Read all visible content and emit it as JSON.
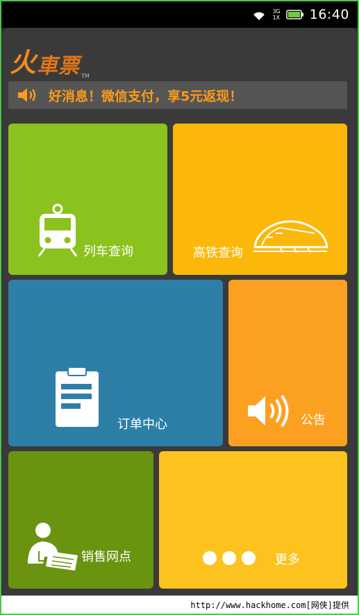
{
  "status_bar": {
    "network_top": "3G",
    "network_bottom": "1X",
    "time": "16:40"
  },
  "app": {
    "logo_text_big": "火",
    "logo_text_rest": "車票",
    "logo_tm": "TM",
    "notice_banner": "好消息！微信支付，享5元返现！"
  },
  "tiles": {
    "train_query": "列车查询",
    "hsr_query": "高铁查询",
    "order_center": "订单中心",
    "announcement": "公告",
    "sales_outlets": "销售网点",
    "more": "更多"
  },
  "colors": {
    "train": "#8cc21e",
    "hsr": "#fbb80b",
    "order": "#2e7fa8",
    "notice": "#fca022",
    "sales": "#6a9410",
    "more": "#fcc21e",
    "accent_text": "#ff9a1a"
  },
  "footer": {
    "watermark": "http://www.hackhome.com[网侠]提供"
  }
}
